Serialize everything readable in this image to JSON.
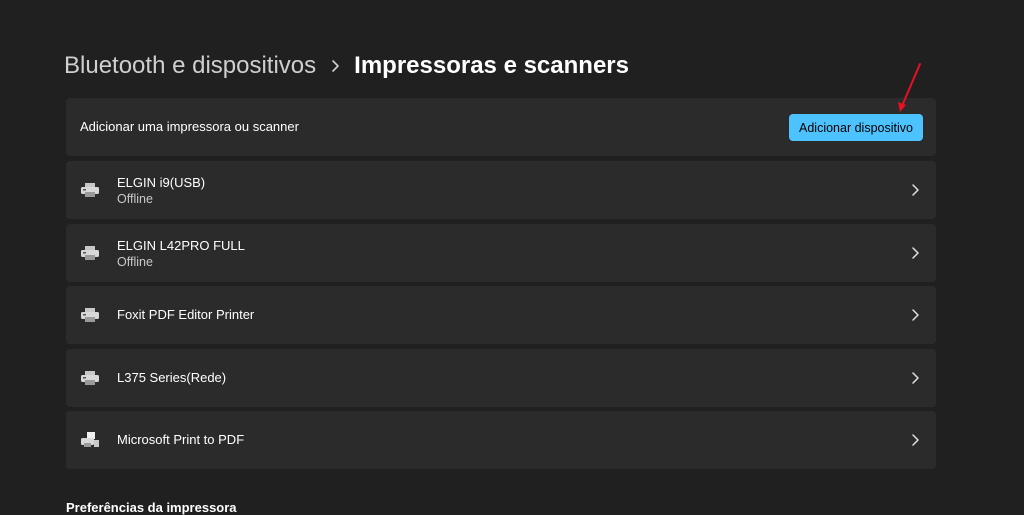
{
  "breadcrumb": {
    "parent": "Bluetooth e dispositivos",
    "current": "Impressoras e scanners"
  },
  "add_device": {
    "label": "Adicionar uma impressora ou scanner",
    "button_label": "Adicionar dispositivo"
  },
  "devices": [
    {
      "name": "ELGIN i9(USB)",
      "status": "Offline",
      "icon": "printer-icon"
    },
    {
      "name": "ELGIN L42PRO FULL",
      "status": "Offline",
      "icon": "printer-icon"
    },
    {
      "name": "Foxit PDF Editor Printer",
      "status": "",
      "icon": "printer-icon"
    },
    {
      "name": "L375 Series(Rede)",
      "status": "",
      "icon": "printer-icon"
    },
    {
      "name": "Microsoft Print to PDF",
      "status": "",
      "icon": "pdf-printer-icon"
    }
  ],
  "preferences": {
    "title": "Preferências da impressora"
  },
  "colors": {
    "background": "#202020",
    "card": "#2b2b2b",
    "accent": "#4cc2ff",
    "annotation": "#e81123"
  }
}
